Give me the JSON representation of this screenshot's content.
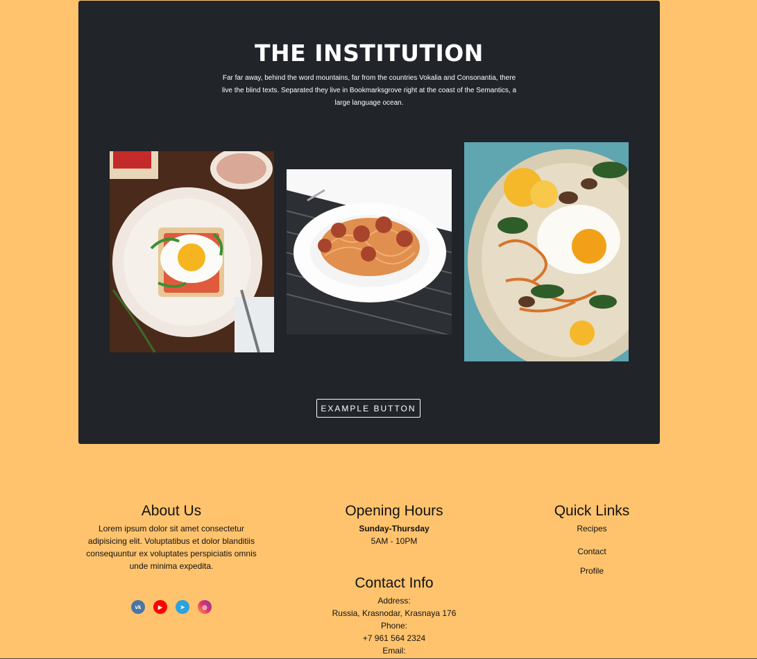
{
  "hero": {
    "title": "THE INSTITUTION",
    "text": "Far far away, behind the word mountains, far from the countries Vokalia and Consonantia, there live the blind texts. Separated they live in Bookmarksgrove right at the coast of the Semantics, a large language ocean.",
    "button_label": "EXAMPLE BUTTON",
    "background_color": "#212429"
  },
  "footer": {
    "background_color": "#ffc36e",
    "about": {
      "title": "About Us",
      "text": "Lorem ipsum dolor sit amet consectetur adipisicing elit. Voluptatibus et dolor blanditiis consequuntur ex voluptates perspiciatis omnis unde minima expedita."
    },
    "hours": {
      "title": "Opening Hours",
      "days": "Sunday-Thursday",
      "time": "5AM - 10PM"
    },
    "contact": {
      "title": "Contact Info",
      "address_label": "Address:",
      "address": "Russia, Krasnodar, Krasnaya 176",
      "phone_label": "Phone:",
      "phone": "+7 961 564 2324",
      "email_label": "Email:"
    },
    "links": {
      "title": "Quick Links",
      "items": [
        "Recipes",
        "Contact",
        "Profile"
      ]
    },
    "socials": [
      {
        "icon": "vk-icon",
        "glyph": "vk"
      },
      {
        "icon": "youtube-icon",
        "glyph": "▶"
      },
      {
        "icon": "telegram-icon",
        "glyph": "➤"
      },
      {
        "icon": "instagram-icon",
        "glyph": "◎"
      }
    ]
  }
}
